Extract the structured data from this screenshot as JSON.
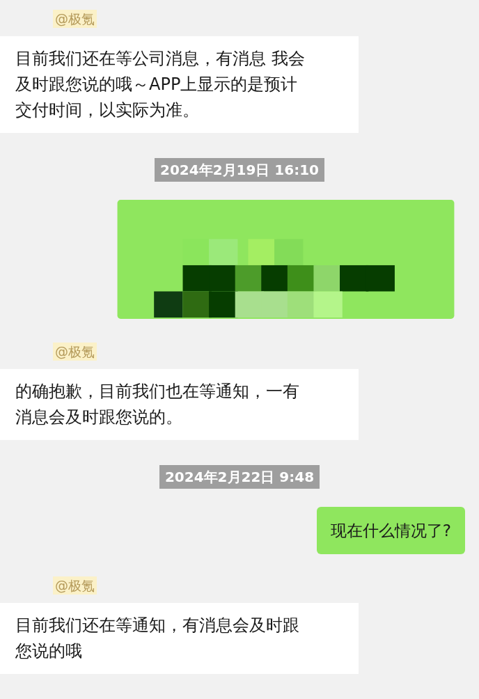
{
  "messages": [
    {
      "kind": "sender",
      "text": "@极氪"
    },
    {
      "kind": "incoming",
      "text": "目前我们还在等公司消息，有消息 我会及时跟您说的哦～APP上显示的是预计交付时间，以实际为准。"
    },
    {
      "kind": "time",
      "text": "2024年2月19日 16:10"
    },
    {
      "kind": "redacted"
    },
    {
      "kind": "sender",
      "text": "@极氪"
    },
    {
      "kind": "incoming",
      "text": "的确抱歉，目前我们也在等通知，一有消息会及时跟您说的。"
    },
    {
      "kind": "time",
      "text": "2024年2月22日 9:48"
    },
    {
      "kind": "outgoing",
      "text": "现在什么情况了?"
    },
    {
      "kind": "sender",
      "text": "@极氪"
    },
    {
      "kind": "incoming",
      "text": "目前我们还在等通知，有消息会及时跟您说的哦"
    }
  ]
}
